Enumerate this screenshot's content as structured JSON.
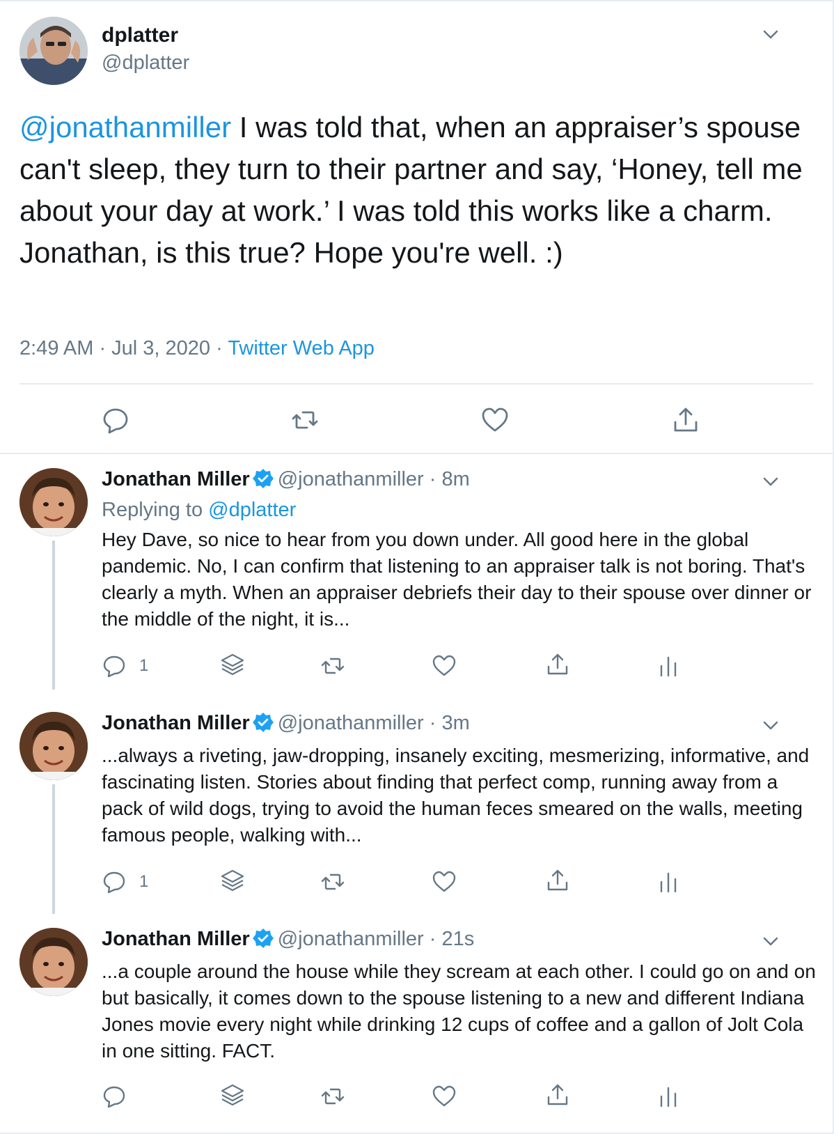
{
  "main_tweet": {
    "name": "dplatter",
    "handle": "@dplatter",
    "mention": "@jonathanmiller",
    "text": " I was told that, when an appraiser’s spouse can't sleep, they turn to their partner and say, ‘Honey, tell me about your day at work.’ I was told this works like a charm. Jonathan, is this true? Hope you're well. :)",
    "timestamp": "2:49 AM · Jul 3, 2020 · ",
    "source": "Twitter Web App",
    "actions": [
      "reply-icon",
      "retweet-icon",
      "like-icon",
      "share-icon"
    ]
  },
  "replies": [
    {
      "name": "Jonathan Miller",
      "handle": "@jonathanmiller · 8m",
      "replying_prefix": "Replying to ",
      "replying_to": "@dplatter",
      "text": "Hey Dave, so nice to hear from you down under. All good here in the global pandemic. No, I can confirm that listening to an appraiser talk is not boring. That's clearly a myth. When an appraiser debriefs their day to their spouse over dinner or the middle of the night, it is...",
      "reply_count": "1"
    },
    {
      "name": "Jonathan Miller",
      "handle": "@jonathanmiller · 3m",
      "text": "...always a riveting, jaw-dropping, insanely exciting, mesmerizing, informative, and fascinating listen. Stories about finding that perfect comp, running away from a pack of wild dogs, trying to avoid the human feces smeared on the walls, meeting famous people, walking with...",
      "reply_count": "1"
    },
    {
      "name": "Jonathan Miller",
      "handle": "@jonathanmiller · 21s",
      "text": "...a couple around the house while they scream at each other. I could go on and on but basically, it comes down to the spouse listening to a new and different Indiana Jones movie every night while drinking 12 cups of coffee and a gallon of Jolt Cola in one sitting. FACT.",
      "reply_count": ""
    }
  ],
  "colors": {
    "link": "#1b95e0",
    "muted": "#657786",
    "text": "#14171a",
    "verified": "#1da1f2"
  }
}
